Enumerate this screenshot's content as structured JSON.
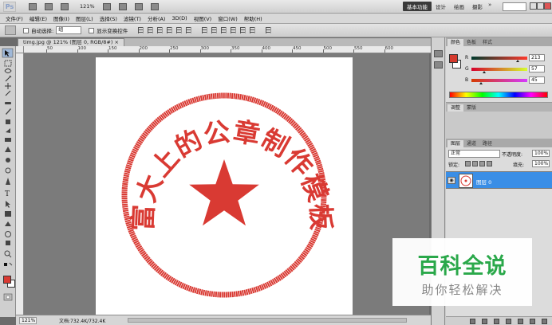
{
  "app": {
    "logo": "Ps",
    "zoom": "121%",
    "workspaces": [
      "基本功能",
      "设计",
      "绘画",
      "摄影"
    ],
    "workspace_active_index": 0,
    "workspace_more": "»"
  },
  "menu": [
    "文件(F)",
    "编辑(E)",
    "图像(I)",
    "图层(L)",
    "选择(S)",
    "滤镜(T)",
    "分析(A)",
    "3D(D)",
    "视图(V)",
    "窗口(W)",
    "帮助(H)"
  ],
  "options": {
    "auto_select_label": "自动选择:",
    "auto_select_value": "组",
    "show_transform_label": "显示变换控件"
  },
  "document": {
    "tab_title": "timg.jpg @ 121% (图层 0, RGB/8#) ×",
    "ruler_labels": [
      "50",
      "100",
      "150",
      "200",
      "250",
      "300",
      "350",
      "400",
      "450",
      "500",
      "550",
      "600"
    ],
    "stamp_text": "富大上的公章制作模板",
    "stamp_color": "#d93a33"
  },
  "status": {
    "zoom": "121%",
    "doc_info": "文档:732.4K/732.4K"
  },
  "color_panel": {
    "tabs": [
      "颜色",
      "色板",
      "样式"
    ],
    "fg_color": "#d53a2d",
    "channels": [
      {
        "name": "R",
        "value": "213",
        "fraction": 0.835
      },
      {
        "name": "G",
        "value": "57",
        "fraction": 0.224
      },
      {
        "name": "B",
        "value": "45",
        "fraction": 0.176
      }
    ]
  },
  "adjust_panel": {
    "tabs": [
      "调整",
      "蒙版"
    ]
  },
  "layers_panel": {
    "tabs": [
      "图层",
      "通道",
      "路径"
    ],
    "blend_mode": "正常",
    "opacity_label": "不透明度:",
    "opacity_value": "100%",
    "lock_label": "锁定:",
    "fill_label": "填充:",
    "fill_value": "100%",
    "layer_name": "图层 0"
  },
  "watermark": {
    "title": "百科全说",
    "subtitle": "助你轻松解决"
  }
}
